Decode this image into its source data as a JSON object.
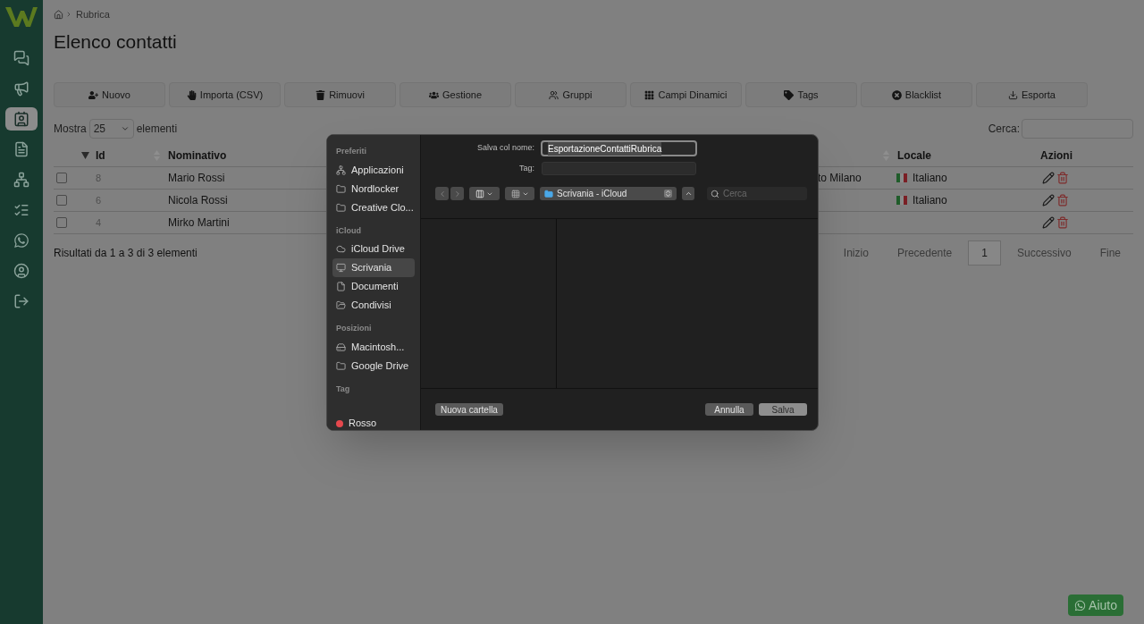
{
  "nav": [
    {
      "kind": "chat",
      "selected": false
    },
    {
      "kind": "campaigns",
      "selected": false
    },
    {
      "kind": "contacts",
      "selected": true
    },
    {
      "kind": "documents",
      "selected": false
    },
    {
      "kind": "flows",
      "selected": false
    },
    {
      "kind": "tasks",
      "selected": false
    },
    {
      "kind": "whatsapp",
      "selected": false
    },
    {
      "kind": "account",
      "selected": false
    },
    {
      "kind": "logout",
      "selected": false
    }
  ],
  "breadcrumb": {
    "label": "Rubrica"
  },
  "title": "Elenco contatti",
  "toolbar": [
    {
      "kind": "new",
      "label": "Nuovo"
    },
    {
      "kind": "import",
      "label": "Importa (CSV)"
    },
    {
      "kind": "remove",
      "label": "Rimuovi"
    },
    {
      "kind": "manage",
      "label": "Gestione"
    },
    {
      "kind": "groups",
      "label": "Gruppi"
    },
    {
      "kind": "fields",
      "label": "Campi Dinamici"
    },
    {
      "kind": "tags",
      "label": "Tags"
    },
    {
      "kind": "blacklist",
      "label": "Blacklist"
    },
    {
      "kind": "export",
      "label": "Esporta"
    }
  ],
  "length": {
    "prefix": "Mostra",
    "value": "25",
    "suffix": "elementi"
  },
  "search": {
    "label": "Cerca:"
  },
  "table": {
    "columns": [
      {
        "label": "Id",
        "sorted": true
      },
      {
        "label": "Nominativo",
        "sorted": false
      },
      {
        "label": "Locale",
        "sorted": false
      },
      {
        "label": "Azioni"
      }
    ],
    "rows": [
      {
        "checked": false,
        "id": "8",
        "name": "Mario Rossi",
        "column_3": "to Milano",
        "locale": "Italiano"
      },
      {
        "checked": false,
        "id": "6",
        "name": "Nicola Rossi",
        "locale": "Italiano"
      },
      {
        "checked": false,
        "id": "4",
        "name": "Mirko Martini"
      }
    ]
  },
  "info": "Risultati da 1 a 3 di 3 elementi",
  "pagination": [
    {
      "label": "Inizio",
      "selected": false
    },
    {
      "label": "Precedente",
      "selected": false
    },
    {
      "label": "1",
      "selected": true
    },
    {
      "label": "Successivo",
      "selected": false
    },
    {
      "label": "Fine",
      "selected": false
    }
  ],
  "dialog": {
    "save_as": {
      "label": "Salva col nome:",
      "value": "EsportazioneContattiRubrica"
    },
    "tag": {
      "label": "Tag:"
    },
    "sidebar": [
      {
        "title": "Preferiti",
        "items": [
          {
            "kind": "apps",
            "label": "Applicazioni",
            "selected": false
          },
          {
            "kind": "folder",
            "label": "Nordlocker",
            "selected": false
          },
          {
            "kind": "folder",
            "label": "Creative Clo...",
            "selected": false
          }
        ]
      },
      {
        "title": "iCloud",
        "items": [
          {
            "kind": "cloud",
            "label": "iCloud Drive",
            "selected": false
          },
          {
            "kind": "desktop",
            "label": "Scrivania",
            "selected": true
          },
          {
            "kind": "document",
            "label": "Documenti",
            "selected": false
          },
          {
            "kind": "shared",
            "label": "Condivisi",
            "selected": false
          }
        ]
      },
      {
        "title": "Posizioni",
        "items": [
          {
            "kind": "disk",
            "label": "Macintosh...",
            "selected": false
          },
          {
            "kind": "folder",
            "label": "Google Drive",
            "selected": false
          }
        ]
      },
      {
        "title": "Tag",
        "items": [
          {
            "kind": "tag",
            "label": "Rosso",
            "color": "#e5484d",
            "selected": false
          }
        ]
      }
    ],
    "location": "Scrivania - iCloud",
    "search_placeholder": "Cerca",
    "new_folder": "Nuova cartella",
    "cancel": "Annulla",
    "save": "Salva"
  },
  "help": "Aiuto"
}
